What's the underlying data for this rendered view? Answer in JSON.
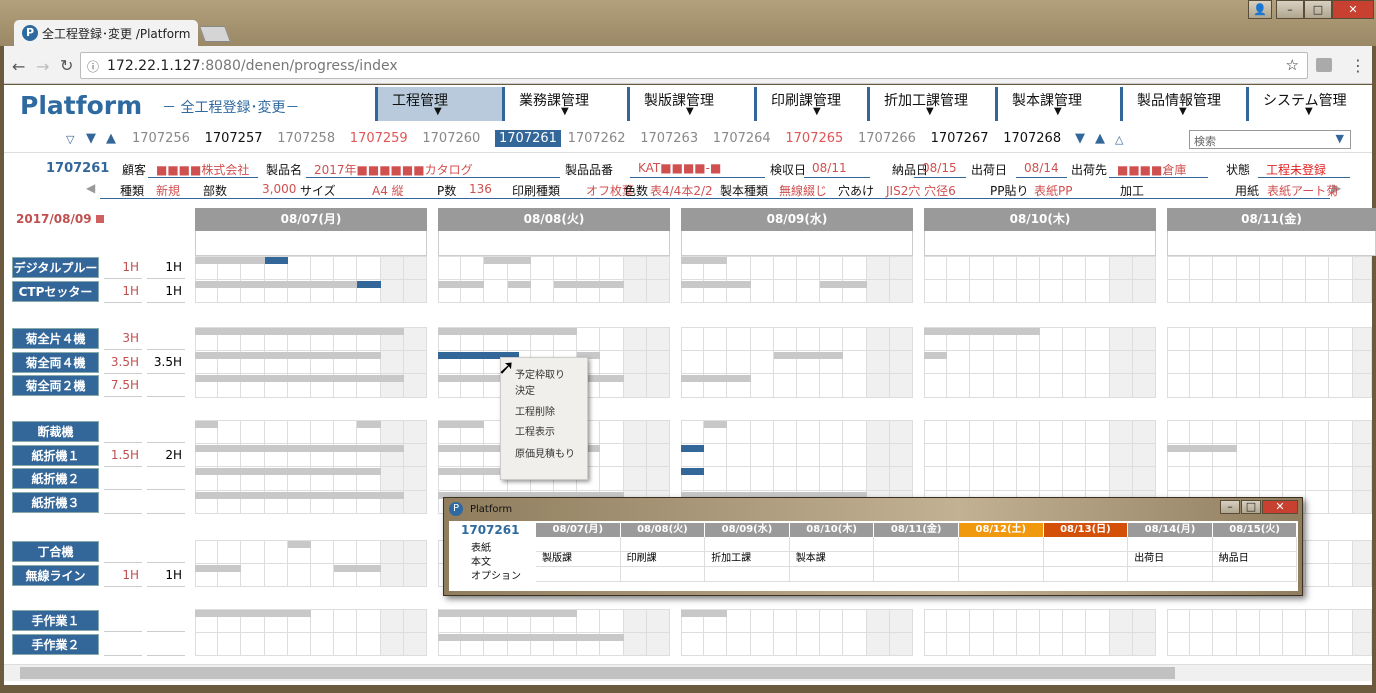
{
  "browser": {
    "tab_title": "全工程登録･変更 /Platform",
    "url_host": "172.22.1.127",
    "url_path": ":8080/denen/progress/index",
    "window_buttons": [
      "–",
      "□",
      "✕"
    ]
  },
  "header": {
    "logo": "Platform",
    "subtitle": "－ 全工程登録･変更－",
    "nav": [
      {
        "label": "工程管理",
        "active": true
      },
      {
        "label": "業務課管理"
      },
      {
        "label": "製版課管理"
      },
      {
        "label": "印刷課管理"
      },
      {
        "label": "折加工課管理"
      },
      {
        "label": "製本課管理"
      },
      {
        "label": "製品情報管理"
      },
      {
        "label": "システム管理"
      }
    ]
  },
  "id_bar": {
    "ids": [
      {
        "id": "1707256",
        "color": "#888888"
      },
      {
        "id": "1707257",
        "color": "#111111"
      },
      {
        "id": "1707258",
        "color": "#888888"
      },
      {
        "id": "1707259",
        "color": "#e05555"
      },
      {
        "id": "1707260",
        "color": "#888888"
      },
      {
        "id": "1707261",
        "color": "#ffffff",
        "selected": true
      },
      {
        "id": "1707262",
        "color": "#888888"
      },
      {
        "id": "1707263",
        "color": "#888888"
      },
      {
        "id": "1707264",
        "color": "#888888"
      },
      {
        "id": "1707265",
        "color": "#e05555"
      },
      {
        "id": "1707266",
        "color": "#888888"
      },
      {
        "id": "1707267",
        "color": "#111111"
      },
      {
        "id": "1707268",
        "color": "#111111"
      }
    ],
    "search_placeholder": "検索"
  },
  "info": {
    "order_id": "1707261",
    "row1": [
      {
        "label": "顧客",
        "value": "■■■■株式会社"
      },
      {
        "label": "製品名",
        "value": "2017年■■■■■■カタログ"
      },
      {
        "label": "製品品番",
        "value": "KAT■■■■-■"
      },
      {
        "label": "検収日",
        "value": "08/11"
      },
      {
        "label": "納品日",
        "value": "08/15"
      },
      {
        "label": "出荷日",
        "value": "08/14"
      },
      {
        "label": "出荷先",
        "value": "■■■■倉庫"
      },
      {
        "label": "状態",
        "value": "工程未登録"
      }
    ],
    "row2": [
      {
        "label": "種類",
        "value": "新規"
      },
      {
        "label": "部数",
        "value": "3,000"
      },
      {
        "label": "サイズ",
        "value": "A4 縦"
      },
      {
        "label": "P数",
        "value": "136"
      },
      {
        "label": "印刷種類",
        "value": "オフ枚葉"
      },
      {
        "label": "色数",
        "value": "表4/4本2/2"
      },
      {
        "label": "製本種類",
        "value": "無線綴じ"
      },
      {
        "label": "穴あけ",
        "value": "JIS2穴 穴径6"
      },
      {
        "label": "PP貼り",
        "value": "表紙PP"
      },
      {
        "label": "加工",
        "value": ""
      },
      {
        "label": "用紙",
        "value": "表紙アート菊"
      }
    ]
  },
  "schedule": {
    "date": "2017/08/09",
    "days": [
      "08/07(月)",
      "08/08(火)",
      "08/09(水)",
      "08/10(木)",
      "08/11(金)"
    ],
    "groups": [
      {
        "machines": [
          {
            "name": "デジタルプルーフ",
            "planned": "1H",
            "actual": "1H"
          },
          {
            "name": "CTPセッター",
            "planned": "1H",
            "actual": "1H"
          }
        ]
      },
      {
        "machines": [
          {
            "name": "菊全片４機",
            "planned": "3H",
            "actual": ""
          },
          {
            "name": "菊全両４機",
            "planned": "3.5H",
            "actual": "3.5H"
          },
          {
            "name": "菊全両２機",
            "planned": "7.5H",
            "actual": ""
          }
        ]
      },
      {
        "machines": [
          {
            "name": "断裁機",
            "planned": "",
            "actual": ""
          },
          {
            "name": "紙折機１",
            "planned": "1.5H",
            "actual": "2H"
          },
          {
            "name": "紙折機２",
            "planned": "",
            "actual": ""
          },
          {
            "name": "紙折機３",
            "planned": "",
            "actual": ""
          }
        ]
      },
      {
        "machines": [
          {
            "name": "丁合機",
            "planned": "",
            "actual": ""
          },
          {
            "name": "無線ライン",
            "planned": "1H",
            "actual": "1H"
          }
        ]
      },
      {
        "machines": [
          {
            "name": "手作業１",
            "planned": "",
            "actual": ""
          },
          {
            "name": "手作業２",
            "planned": "",
            "actual": ""
          }
        ]
      }
    ],
    "blocks": [
      [
        0,
        0,
        0,
        0,
        3,
        "gray"
      ],
      [
        0,
        0,
        0,
        3,
        1,
        "blue"
      ],
      [
        0,
        0,
        1,
        2,
        2,
        "gray"
      ],
      [
        0,
        0,
        2,
        0,
        2,
        "gray"
      ],
      [
        0,
        1,
        0,
        0,
        7,
        "gray"
      ],
      [
        0,
        1,
        0,
        7,
        1,
        "blue"
      ],
      [
        0,
        1,
        1,
        0,
        2,
        "gray"
      ],
      [
        0,
        1,
        1,
        3,
        1,
        "gray"
      ],
      [
        0,
        1,
        1,
        5,
        3,
        "gray"
      ],
      [
        0,
        1,
        2,
        0,
        3,
        "gray"
      ],
      [
        0,
        1,
        2,
        6,
        2,
        "gray"
      ],
      [
        1,
        0,
        0,
        0,
        9,
        "gray"
      ],
      [
        1,
        0,
        1,
        0,
        6,
        "gray"
      ],
      [
        1,
        0,
        3,
        0,
        5,
        "gray"
      ],
      [
        1,
        1,
        0,
        0,
        8,
        "gray"
      ],
      [
        1,
        1,
        1,
        0,
        3.5,
        "blue"
      ],
      [
        1,
        1,
        1,
        6,
        1,
        "gray"
      ],
      [
        1,
        1,
        2,
        4,
        3,
        "gray"
      ],
      [
        1,
        1,
        3,
        0,
        1,
        "gray"
      ],
      [
        1,
        2,
        0,
        0,
        9,
        "gray"
      ],
      [
        1,
        2,
        1,
        0,
        8,
        "gray"
      ],
      [
        1,
        2,
        2,
        0,
        3,
        "gray"
      ],
      [
        2,
        0,
        0,
        0,
        1,
        "gray"
      ],
      [
        2,
        0,
        0,
        7,
        1,
        "gray"
      ],
      [
        2,
        0,
        1,
        0,
        2,
        "gray"
      ],
      [
        2,
        0,
        2,
        1,
        1,
        "gray"
      ],
      [
        2,
        1,
        0,
        0,
        9,
        "gray"
      ],
      [
        2,
        1,
        1,
        0,
        7,
        "gray"
      ],
      [
        2,
        1,
        2,
        0,
        1,
        "blue"
      ],
      [
        2,
        1,
        4,
        0,
        3,
        "gray"
      ],
      [
        2,
        2,
        0,
        0,
        8,
        "gray"
      ],
      [
        2,
        2,
        1,
        0,
        6,
        "gray"
      ],
      [
        2,
        2,
        2,
        0,
        1,
        "blue"
      ],
      [
        2,
        3,
        0,
        0,
        9,
        "gray"
      ],
      [
        2,
        3,
        1,
        0,
        8,
        "gray"
      ],
      [
        2,
        3,
        2,
        0,
        8,
        "gray"
      ],
      [
        3,
        0,
        0,
        4,
        1,
        "gray"
      ],
      [
        3,
        1,
        0,
        0,
        2,
        "gray"
      ],
      [
        3,
        1,
        0,
        6,
        2,
        "gray"
      ],
      [
        4,
        0,
        0,
        0,
        5,
        "gray"
      ],
      [
        4,
        0,
        1,
        0,
        6,
        "gray"
      ],
      [
        4,
        0,
        2,
        0,
        2,
        "gray"
      ],
      [
        4,
        1,
        1,
        0,
        8,
        "gray"
      ]
    ]
  },
  "context_menu": [
    "予定枠取り",
    "決定",
    "工程削除",
    "工程表示",
    "原価見積もり"
  ],
  "popup": {
    "title": "Platform",
    "order_id": "1707261",
    "rows": [
      "表紙",
      "本文",
      "オプション"
    ],
    "days": [
      {
        "label": "08/07(月)",
        "color": "#9a9a9a"
      },
      {
        "label": "08/08(火)",
        "color": "#9a9a9a"
      },
      {
        "label": "08/09(水)",
        "color": "#9a9a9a"
      },
      {
        "label": "08/10(木)",
        "color": "#9a9a9a"
      },
      {
        "label": "08/11(金)",
        "color": "#9a9a9a"
      },
      {
        "label": "08/12(土)",
        "color": "#f0980e"
      },
      {
        "label": "08/13(日)",
        "color": "#d45008"
      },
      {
        "label": "08/14(月)",
        "color": "#9a9a9a"
      },
      {
        "label": "08/15(火)",
        "color": "#9a9a9a"
      }
    ],
    "honbun": [
      "製版課",
      "印刷課",
      "折加工課",
      "製本課",
      "",
      "",
      "",
      "出荷日",
      "納品日"
    ]
  }
}
